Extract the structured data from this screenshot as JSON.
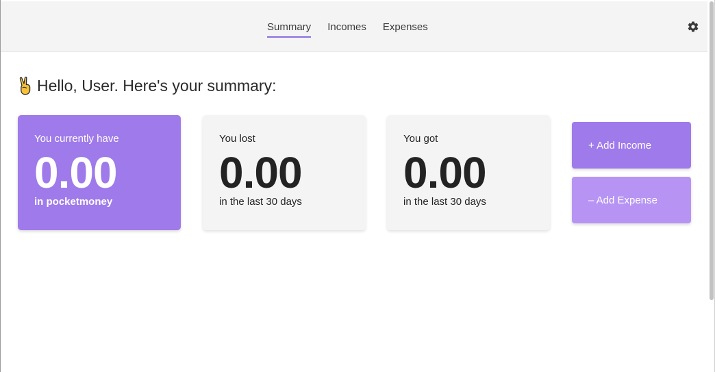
{
  "nav": {
    "tabs": [
      {
        "label": "Summary",
        "active": true
      },
      {
        "label": "Incomes",
        "active": false
      },
      {
        "label": "Expenses",
        "active": false
      }
    ],
    "settings_icon": "gear-icon"
  },
  "greeting": {
    "emoji_icon": "victory-hand-icon",
    "text": "Hello, User. Here's your summary:"
  },
  "cards": {
    "balance": {
      "label": "You currently have",
      "value": "0.00",
      "sub": "in pocketmoney"
    },
    "lost": {
      "label": "You lost",
      "value": "0.00",
      "sub": "in the last 30 days"
    },
    "got": {
      "label": "You got",
      "value": "0.00",
      "sub": "in the last 30 days"
    }
  },
  "actions": {
    "add_income": "+ Add Income",
    "add_expense": "– Add Expense"
  },
  "colors": {
    "accent": "#9f7aea",
    "accent_light": "#b794f4",
    "card_neutral": "#f4f4f4",
    "nav_bg": "#f4f4f4"
  }
}
